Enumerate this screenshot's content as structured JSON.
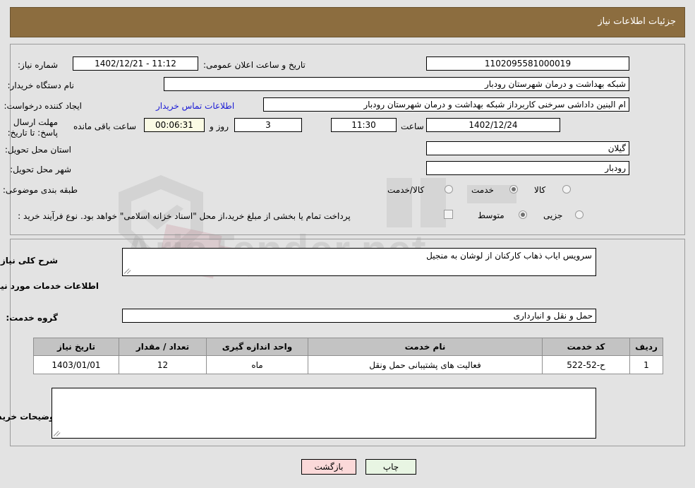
{
  "header": {
    "title": "جزئیات اطلاعات نیاز"
  },
  "top_section": {
    "need_number_label": "شماره نیاز:",
    "need_number_value": "1102095581000019",
    "announce_label": "تاریخ و ساعت اعلان عمومی:",
    "announce_value": "11:12 - 1402/12/21",
    "buyer_org_label": "نام دستگاه خریدار:",
    "buyer_org_value": "شبکه بهداشت و درمان شهرستان رودبار",
    "requester_label": "ایجاد کننده درخواست:",
    "requester_value": "ام البنین داداشی سرخنی کاربرداز شبکه بهداشت و درمان شهرستان رودبار",
    "contact_link": "اطلاعات تماس خریدار",
    "deadline_label": "مهلت ارسال پاسخ: تا تاریخ:",
    "deadline_date": "1402/12/24",
    "deadline_time_label": "ساعت",
    "deadline_time": "11:30",
    "remaining_days": "3",
    "remaining_days_label": "روز و",
    "remaining_hours": "00:06:31",
    "remaining_hours_label": "ساعت باقی مانده",
    "province_label": "استان محل تحویل:",
    "province_value": "گیلان",
    "city_label": "شهر محل تحویل:",
    "city_value": "رودبار",
    "category_label": "طبقه بندی موضوعی:",
    "category_options": [
      {
        "label": "کالا",
        "selected": false
      },
      {
        "label": "خدمت",
        "selected": true
      },
      {
        "label": "کالا/خدمت",
        "selected": false
      }
    ],
    "process_label": "نوع فرآیند خرید :",
    "process_options": [
      {
        "label": "جزیی",
        "selected": false
      },
      {
        "label": "متوسط",
        "selected": true
      }
    ],
    "treasury_checkbox_label": "پرداخت تمام یا بخشی از مبلغ خرید،از محل \"اسناد خزانه اسلامی\" خواهد بود.",
    "treasury_checked": false
  },
  "mid_section": {
    "need_desc_label": "شرح کلی نیاز:",
    "need_desc_value": "سرویس ایاب ذهاب کارکنان از لوشان به منجیل",
    "services_heading": "اطلاعات خدمات مورد نیاز",
    "service_group_label": "گروه خدمت:",
    "service_group_value": "حمل و نقل و انبارداری",
    "buyer_notes_label": "توضیحات خریدار:",
    "buyer_notes_value": ""
  },
  "table": {
    "columns": [
      "ردیف",
      "کد خدمت",
      "نام خدمت",
      "واحد اندازه گیری",
      "تعداد / مقدار",
      "تاریخ نیاز"
    ],
    "rows": [
      {
        "row_no": "1",
        "service_code": "ح-52-522",
        "service_name": "فعالیت های پشتیبانی حمل ونقل",
        "unit": "ماه",
        "quantity": "12",
        "need_date": "1403/01/01"
      }
    ]
  },
  "footer": {
    "print_label": "چاپ",
    "back_label": "بازگشت"
  },
  "watermark": {
    "text": "AriaTender.net"
  },
  "colors": {
    "header_bar": "#8c6d3f",
    "page_bg": "#e3e3e3",
    "link": "#1a1ad6",
    "table_header": "#c3c3c3",
    "countdown_bg": "#fbfbe4",
    "print_btn": "#e8f5e3",
    "back_btn": "#fbd9d9"
  }
}
